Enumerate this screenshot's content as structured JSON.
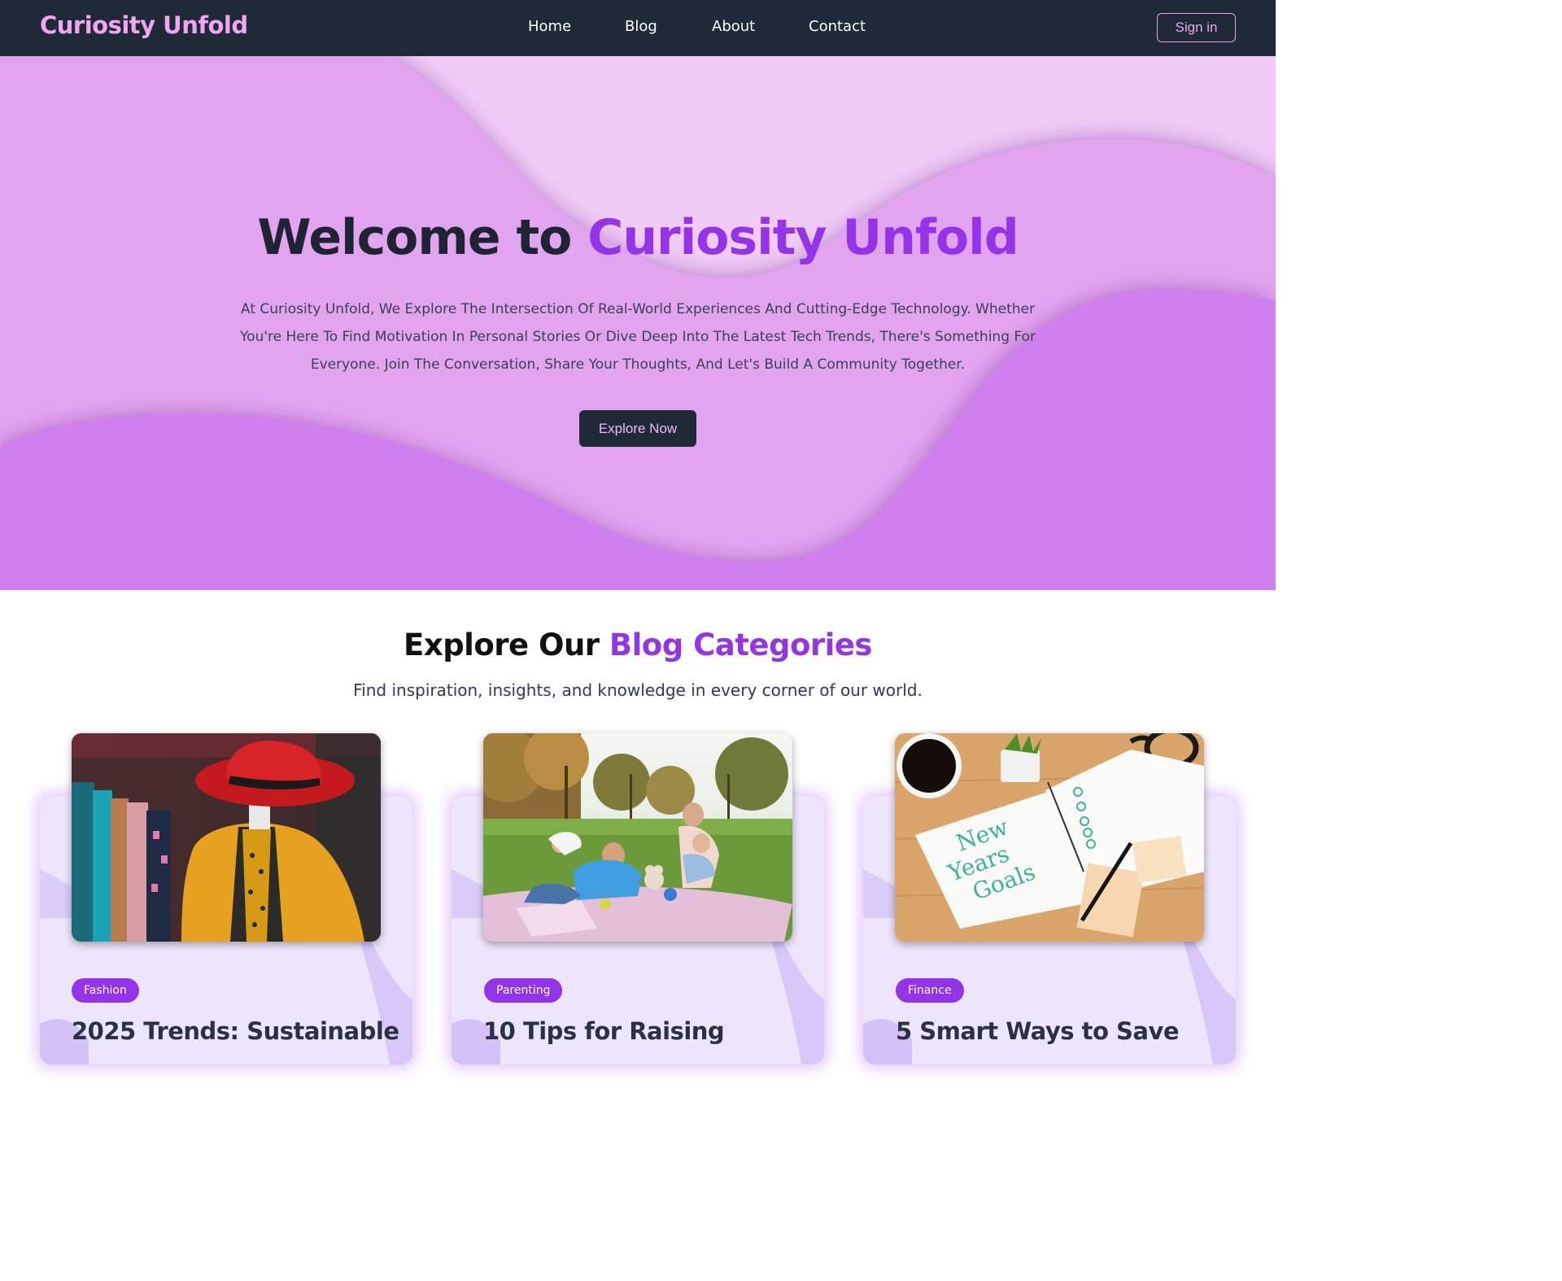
{
  "nav": {
    "brand": "Curiosity Unfold",
    "links": [
      "Home",
      "Blog",
      "About",
      "Contact"
    ],
    "sign_in": "Sign in"
  },
  "hero": {
    "title_plain": "Welcome to ",
    "title_accent": "Curiosity Unfold",
    "description": "At Curiosity Unfold, We Explore The Intersection Of Real-World Experiences And Cutting-Edge Technology. Whether You're Here To Find Motivation In Personal Stories Or Dive Deep Into The Latest Tech Trends, There's Something For Everyone. Join The Conversation, Share Your Thoughts, And Let's Build A Community Together.",
    "cta": "Explore Now"
  },
  "categories": {
    "title_plain": "Explore Our ",
    "title_accent": "Blog Categories",
    "subtitle": "Find inspiration, insights, and knowledge in every corner of our world.",
    "cards": [
      {
        "tag": "Fashion",
        "title": "2025 Trends: Sustainable"
      },
      {
        "tag": "Parenting",
        "title": "10 Tips for Raising"
      },
      {
        "tag": "Finance",
        "title": "5 Smart Ways to Save"
      }
    ],
    "image_text": {
      "goals_line1": "New",
      "goals_line2": "Years",
      "goals_line3": "Goals"
    }
  },
  "colors": {
    "nav_bg": "#1f2937",
    "brand": "#f0a7f0",
    "accent": "#9333ea",
    "hero_light": "#efcbf5",
    "hero_mid": "#e1a4ef",
    "hero_dark": "#cf7eee",
    "card_bg": "#ede5fb"
  }
}
